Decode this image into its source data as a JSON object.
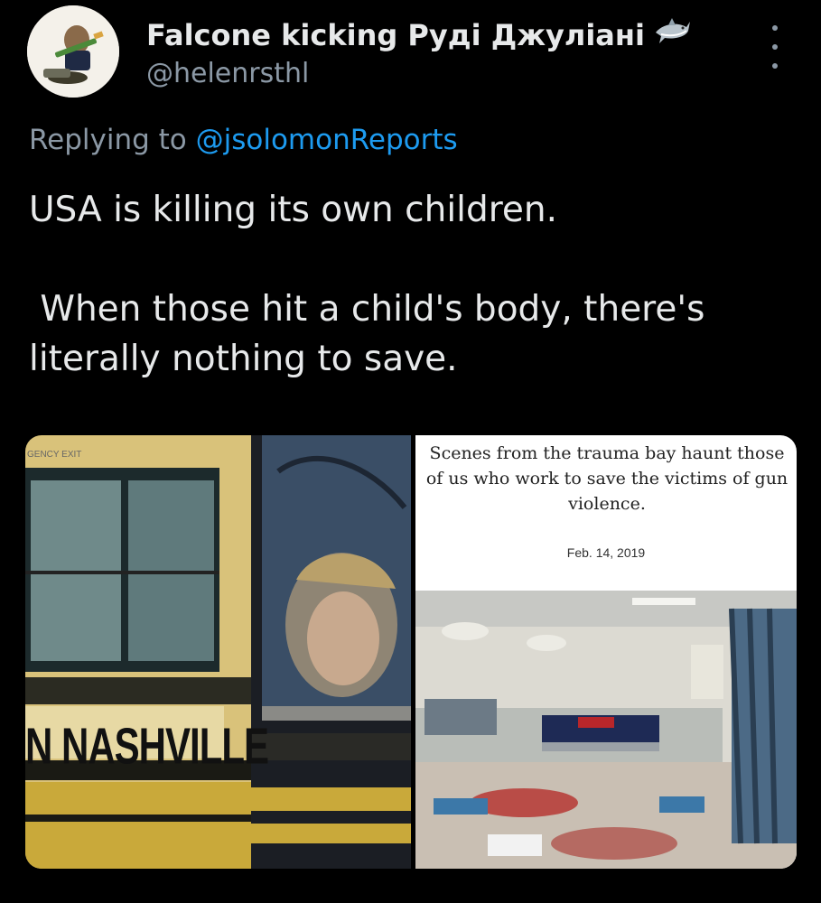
{
  "author": {
    "display_name": "Falcone kicking Руді Джуліані",
    "handle": "@helenrsthl",
    "name_emoji_icon": "shark-icon"
  },
  "reply": {
    "prefix": "Replying to ",
    "mention": "@jsolomonReports"
  },
  "tweet": {
    "text": "USA is killing its own children.\n\n When those hit a child's body, there's literally nothing to save."
  },
  "media": {
    "left_image": {
      "bus_label": "N   NASHVILLE",
      "emergency_label": "GENCY EXIT"
    },
    "right_image": {
      "caption": "Scenes from the trauma bay haunt those of us who work to save the victims of gun violence.",
      "date": "Feb. 14, 2019"
    }
  },
  "colors": {
    "background": "#000000",
    "text": "#e7e9ea",
    "secondary": "#8b98a5",
    "link": "#1d9bf0"
  }
}
